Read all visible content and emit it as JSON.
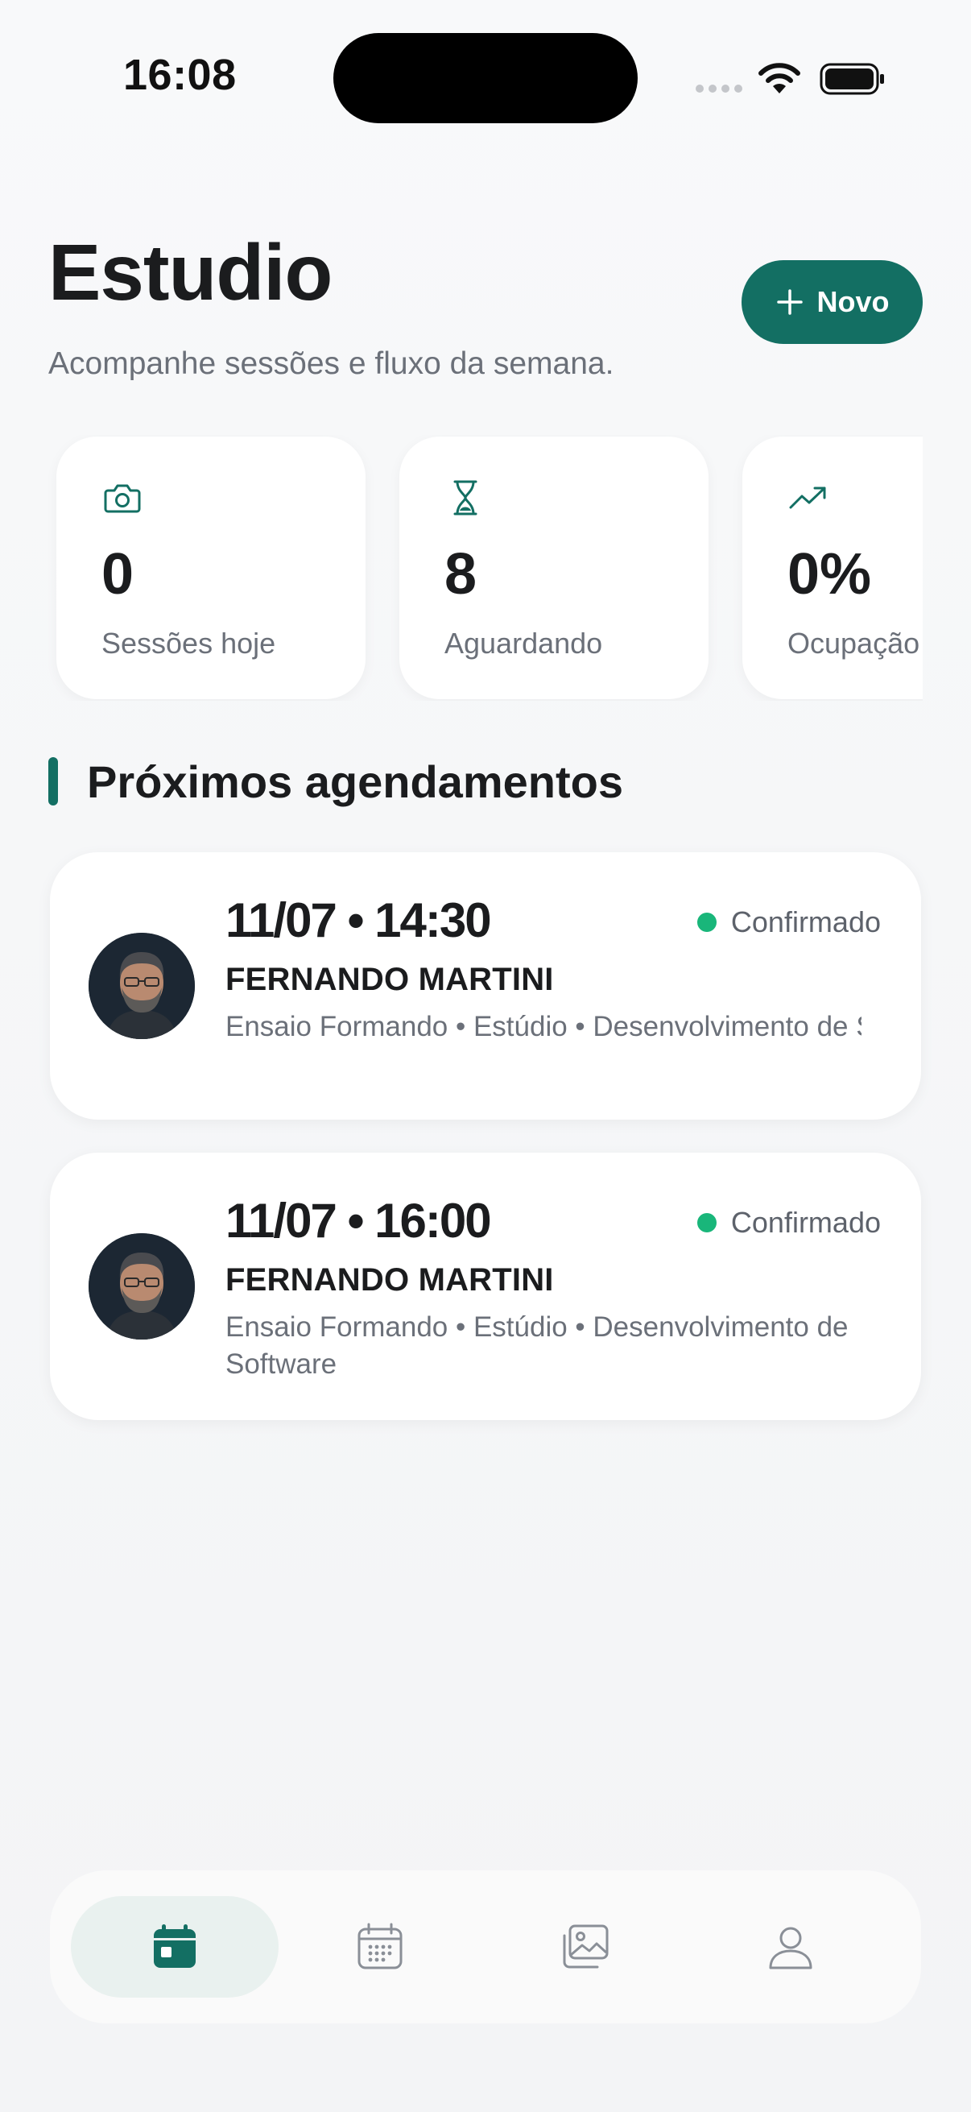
{
  "status_bar": {
    "time": "16:08"
  },
  "header": {
    "title": "Estudio",
    "subtitle": "Acompanhe sessões e fluxo da semana.",
    "new_button": {
      "label": "Novo",
      "icon": "plus-icon"
    }
  },
  "stats": [
    {
      "icon": "camera-icon",
      "value": "0",
      "label": "Sessões hoje"
    },
    {
      "icon": "hourglass-icon",
      "value": "8",
      "label": "Aguardando"
    },
    {
      "icon": "trending-up-icon",
      "value": "0%",
      "label": "Ocupação"
    }
  ],
  "section": {
    "title": "Próximos agendamentos"
  },
  "appointments": [
    {
      "datetime": "11/07 • 14:30",
      "status": "Confirmado",
      "client": "FERNANDO MARTINI",
      "description": "Ensaio Formando • Estúdio • Desenvolvimento de Software"
    },
    {
      "datetime": "11/07 • 16:00",
      "status": "Confirmado",
      "client": "FERNANDO MARTINI",
      "description": "Ensaio Formando • Estúdio • Desenvolvimento de Software"
    }
  ],
  "nav": [
    {
      "icon": "calendar-today-icon",
      "active": true
    },
    {
      "icon": "calendar-grid-icon",
      "active": false
    },
    {
      "icon": "gallery-icon",
      "active": false
    },
    {
      "icon": "profile-icon",
      "active": false
    }
  ],
  "colors": {
    "accent": "#136f63",
    "status_confirmed": "#19b67a",
    "text_primary": "#1b1c1e",
    "text_secondary": "#6b7079"
  }
}
